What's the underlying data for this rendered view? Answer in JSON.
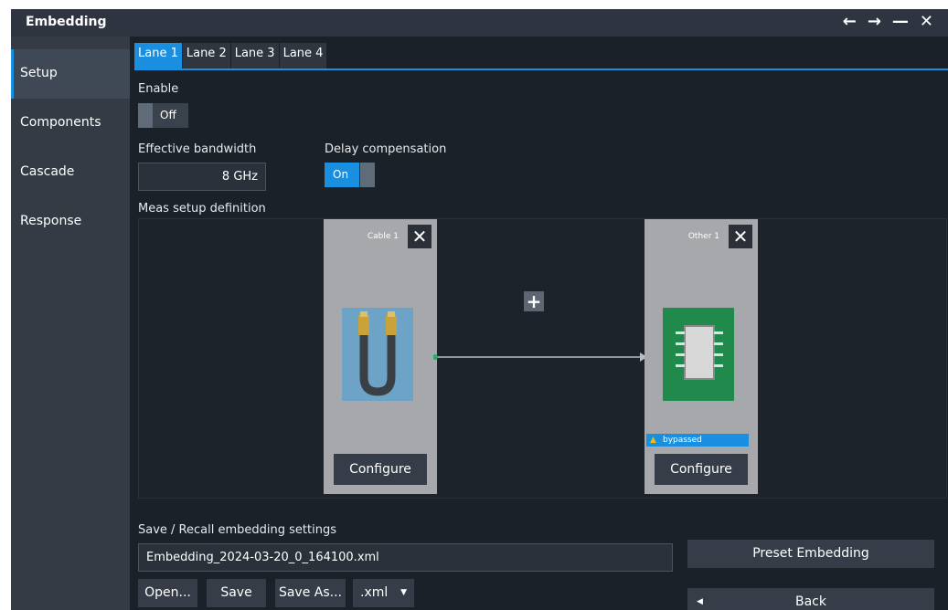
{
  "window": {
    "title": "Embedding"
  },
  "titlebar": {
    "back": "←",
    "forward": "→",
    "minimize": "—",
    "close": "✕"
  },
  "sidebar": {
    "items": [
      {
        "label": "Setup"
      },
      {
        "label": "Components"
      },
      {
        "label": "Cascade"
      },
      {
        "label": "Response"
      }
    ]
  },
  "tabs": [
    {
      "label": "Lane 1"
    },
    {
      "label": "Lane 2"
    },
    {
      "label": "Lane 3"
    },
    {
      "label": "Lane 4"
    }
  ],
  "enable": {
    "label": "Enable",
    "value": "Off"
  },
  "bandwidth": {
    "label": "Effective bandwidth",
    "value": "8 GHz"
  },
  "delay": {
    "label": "Delay compensation",
    "value": "On"
  },
  "meas": {
    "label": "Meas setup definition",
    "components": [
      {
        "name": "Cable 1",
        "configure": "Configure"
      },
      {
        "name": "Other 1",
        "configure": "Configure",
        "badge": "bypassed"
      }
    ],
    "plus": "+",
    "remove": "✕"
  },
  "save_recall": {
    "label": "Save / Recall embedding settings",
    "filename": "Embedding_2024-03-20_0_164100.xml",
    "open": "Open...",
    "save": "Save",
    "save_as": "Save As...",
    "ext": ".xml"
  },
  "preset": "Preset Embedding",
  "back": "Back"
}
